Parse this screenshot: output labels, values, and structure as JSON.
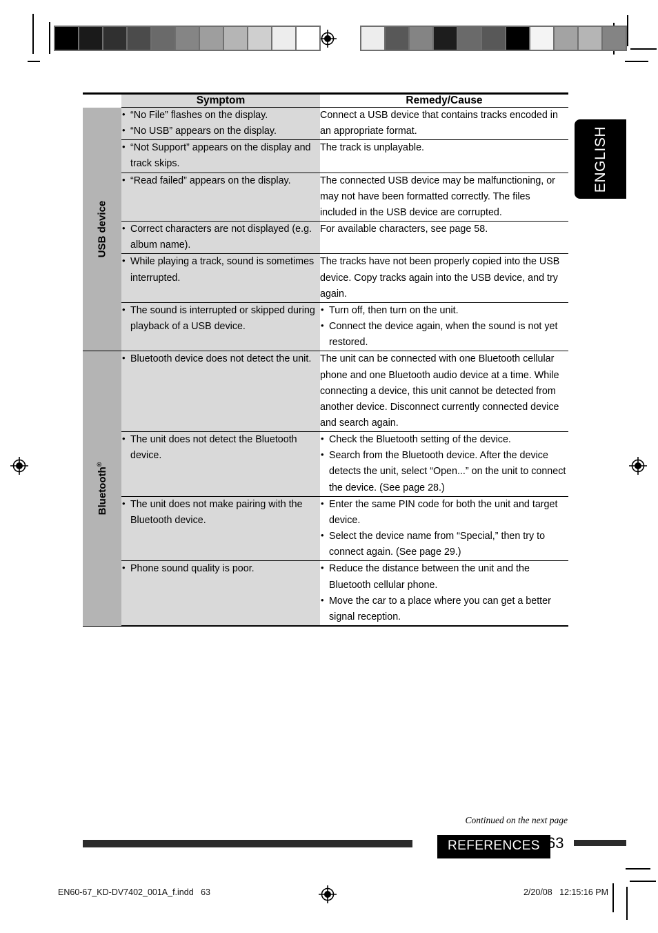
{
  "language_tab": {
    "label": "ENGLISH"
  },
  "table": {
    "headers": {
      "symptom": "Symptom",
      "remedy": "Remedy/Cause"
    },
    "groups": [
      {
        "category": "USB device",
        "category_superscript": "",
        "rows": [
          {
            "symptom_bullets": [
              "“No File” flashes on the display.",
              "“No USB” appears on the display."
            ],
            "remedy_text": "Connect a USB device that contains tracks encoded in an appropriate format.",
            "remedy_bullets": []
          },
          {
            "symptom_bullets": [
              "“Not Support” appears on the display and track skips."
            ],
            "remedy_text": "The track is unplayable.",
            "remedy_bullets": []
          },
          {
            "symptom_bullets": [
              "“Read failed” appears on the display."
            ],
            "remedy_text": "The connected USB device may be malfunctioning, or may not have been formatted correctly. The files included in the USB device are corrupted.",
            "remedy_bullets": []
          },
          {
            "symptom_bullets": [
              "Correct characters are not displayed (e.g. album name)."
            ],
            "remedy_text": "For available characters, see page 58.",
            "remedy_bullets": []
          },
          {
            "symptom_bullets": [
              "While playing a track, sound is sometimes interrupted."
            ],
            "remedy_text": "The tracks have not been properly copied into the USB device. Copy tracks again into the USB device, and try again.",
            "remedy_bullets": []
          },
          {
            "symptom_bullets": [
              "The sound is interrupted or skipped during playback of a USB device."
            ],
            "remedy_text": "",
            "remedy_bullets": [
              "Turn off, then turn on the unit.",
              "Connect the device again, when the sound is not yet restored."
            ]
          }
        ]
      },
      {
        "category": "Bluetooth",
        "category_superscript": "®",
        "rows": [
          {
            "symptom_bullets": [
              "Bluetooth device does not detect the unit."
            ],
            "remedy_text": "The unit can be connected with one Bluetooth cellular phone and one Bluetooth audio device at a time. While connecting a device, this unit cannot be detected from another device. Disconnect currently connected device and search again.",
            "remedy_bullets": []
          },
          {
            "symptom_bullets": [
              "The unit does not detect the Bluetooth device."
            ],
            "remedy_text": "",
            "remedy_bullets": [
              "Check the Bluetooth setting of the device.",
              "Search from the Bluetooth device. After the device detects the unit, select “Open...” on the unit to connect the device. (See page 28.)"
            ]
          },
          {
            "symptom_bullets": [
              "The unit does not make pairing with the Bluetooth device."
            ],
            "remedy_text": "",
            "remedy_bullets": [
              "Enter the same PIN code for both the unit and target device.",
              "Select the device name from “Special,” then try to connect again. (See page 29.)"
            ]
          },
          {
            "symptom_bullets": [
              "Phone sound quality is poor."
            ],
            "remedy_text": "",
            "remedy_bullets": [
              "Reduce the distance between the unit and the Bluetooth cellular phone.",
              "Move the car to a place where you can get a better signal reception."
            ]
          }
        ]
      }
    ]
  },
  "footer": {
    "continued": "Continued on the next page",
    "section": "REFERENCES",
    "page_number": "63"
  },
  "print_meta": {
    "file_name": "EN60-67_KD-DV7402_001A_f.indd   63",
    "date_time": "2/20/08   12:15:16 PM"
  },
  "calibration": {
    "left_strip": [
      "#000000",
      "#1a1a1a",
      "#303030",
      "#4b4b4b",
      "#6a6a6a",
      "#858585",
      "#9e9e9e",
      "#b5b5b5",
      "#cfcfcf",
      "#ededed",
      "#ffffff"
    ],
    "right_strip": [
      "#ededed",
      "#585858",
      "#848484",
      "#1d1d1d",
      "#6a6a6a",
      "#585858",
      "#000000",
      "#f4f4f4",
      "#a3a3a3",
      "#b5b5b5",
      "#848484"
    ]
  }
}
